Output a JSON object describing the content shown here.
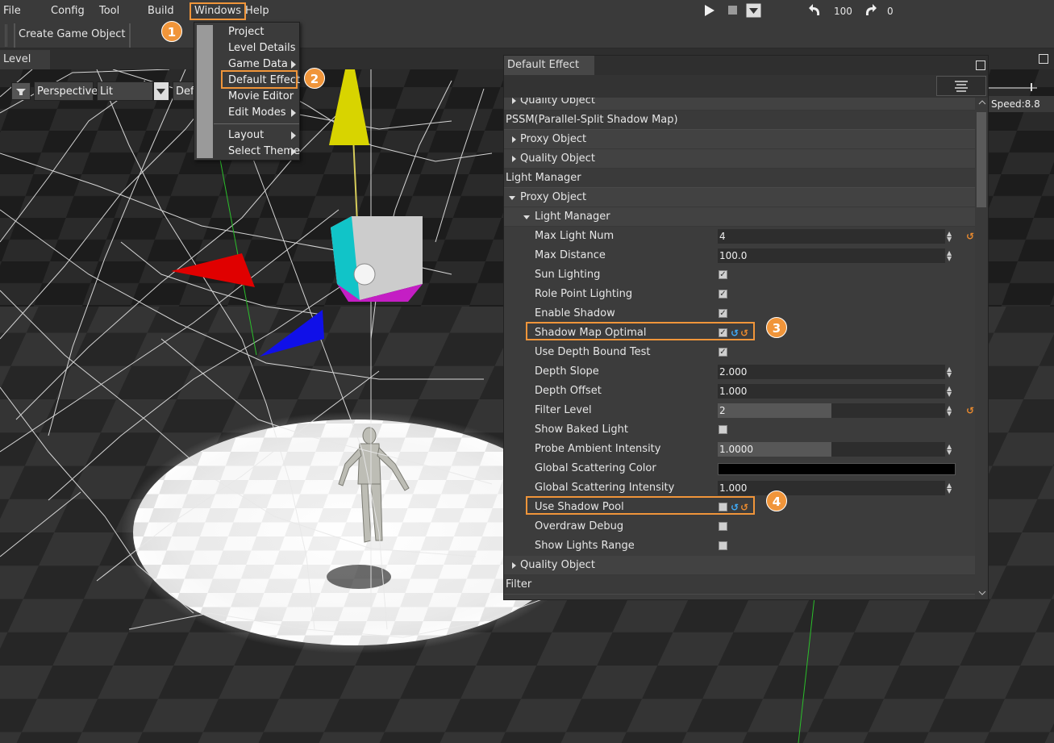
{
  "menu": {
    "file": "File",
    "config": "Config",
    "tool": "Tool",
    "build": "Build",
    "windows": "Windows",
    "help": "Help"
  },
  "playback": {
    "undo_count": "100",
    "redo_count": "0"
  },
  "toolbar": {
    "create_game_object": "Create Game Object"
  },
  "tabs": {
    "level": "Level"
  },
  "viewport": {
    "perspective": "Perspective",
    "lit": "Lit",
    "default_truncated": "Defa",
    "speed": "Speed:8.8"
  },
  "windows_menu": {
    "items": [
      "Project",
      "Level Details",
      "Game Data",
      "Default Effect",
      "Movie Editor",
      "Edit Modes",
      "Layout",
      "Select Theme"
    ]
  },
  "badges": [
    "1",
    "2",
    "3",
    "4"
  ],
  "panel": {
    "title": "Default Effect",
    "rows": {
      "quality_object_top": "Quality Object",
      "pssm": "PSSM(Parallel-Split Shadow Map)",
      "proxy_object_1": "Proxy Object",
      "quality_object_1": "Quality Object",
      "light_manager_section": "Light Manager",
      "proxy_object_2": "Proxy Object",
      "light_manager_group": "Light Manager",
      "max_light_num": {
        "label": "Max Light Num",
        "value": "4"
      },
      "max_distance": {
        "label": "Max Distance",
        "value": "100.0"
      },
      "sun_lighting": {
        "label": "Sun Lighting",
        "checked": true
      },
      "role_point_lighting": {
        "label": "Role Point Lighting",
        "checked": true
      },
      "enable_shadow": {
        "label": "Enable Shadow",
        "checked": true
      },
      "shadow_map_optimal": {
        "label": "Shadow Map Optimal",
        "checked": true
      },
      "use_depth_bound_test": {
        "label": "Use Depth Bound Test",
        "checked": true
      },
      "depth_slope": {
        "label": "Depth Slope",
        "value": "2.000"
      },
      "depth_offset": {
        "label": "Depth Offset",
        "value": "1.000"
      },
      "filter_level": {
        "label": "Filter Level",
        "value": "2"
      },
      "show_baked_light": {
        "label": "Show Baked Light",
        "checked": false
      },
      "probe_ambient_intensity": {
        "label": "Probe Ambient Intensity",
        "value": "1.0000"
      },
      "global_scattering_color": {
        "label": "Global Scattering Color",
        "color": "#000000"
      },
      "global_scattering_intensity": {
        "label": "Global Scattering Intensity",
        "value": "1.000"
      },
      "use_shadow_pool": {
        "label": "Use Shadow Pool",
        "checked": false
      },
      "overdraw_debug": {
        "label": "Overdraw Debug",
        "checked": false
      },
      "show_lights_range": {
        "label": "Show Lights Range",
        "checked": false
      },
      "quality_object_2": "Quality Object",
      "filter_section": "Filter"
    }
  },
  "colors": {
    "highlight": "#f0953a",
    "reset_orange": "#e8892e",
    "reset_blue": "#3fa9f5"
  }
}
